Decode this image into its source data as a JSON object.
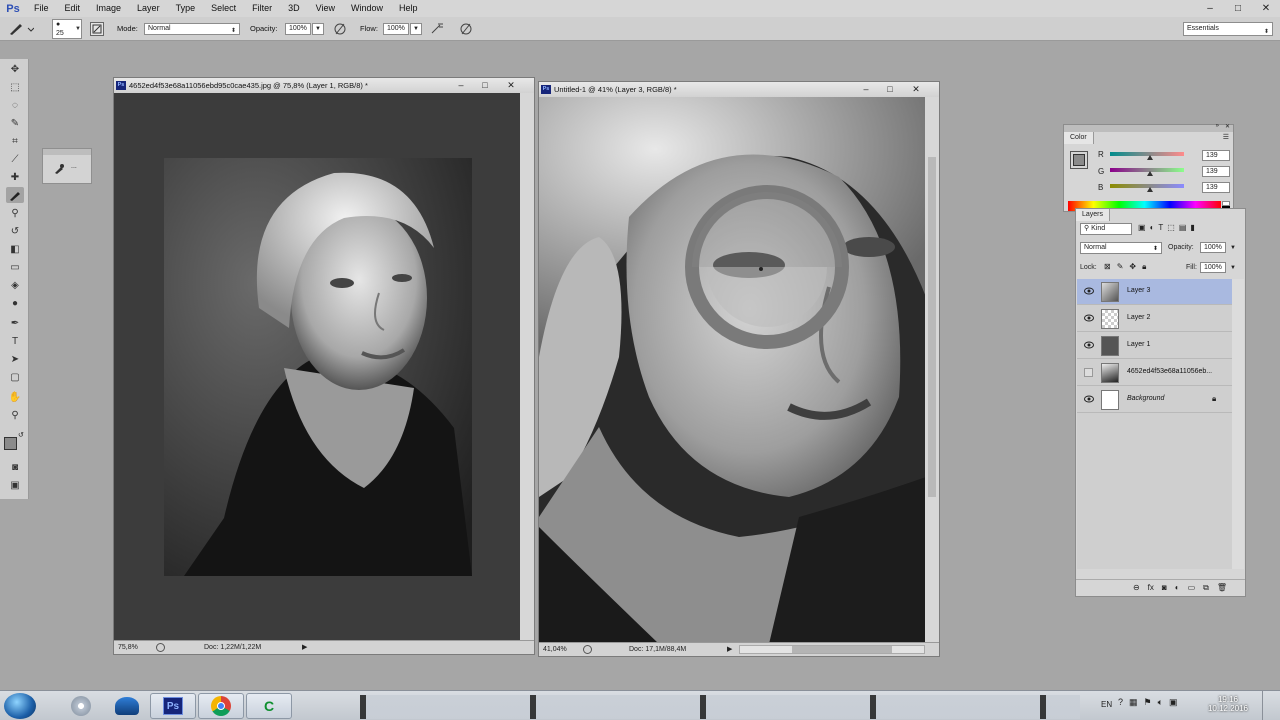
{
  "app": {
    "logo": "Ps"
  },
  "menu": [
    "File",
    "Edit",
    "Image",
    "Layer",
    "Type",
    "Select",
    "Filter",
    "3D",
    "View",
    "Window",
    "Help"
  ],
  "window_controls": {
    "minimize": "–",
    "maximize": "□",
    "close": "✕"
  },
  "options": {
    "brush_size": "25",
    "mode_label": "Mode:",
    "mode_value": "Normal",
    "opacity_label": "Opacity:",
    "opacity_value": "100%",
    "flow_label": "Flow:",
    "flow_value": "100%",
    "workspace": "Essentials"
  },
  "brush_panel": {
    "label": "..."
  },
  "doc1": {
    "title": "4652ed4f53e68a11056ebd95c0cae435.jpg @ 75,8% (Layer 1, RGB/8) *",
    "zoom": "75,8%",
    "doc_info": "Doc: 1,22M/1,22M"
  },
  "doc2": {
    "title": "Untitled-1 @ 41% (Layer 3, RGB/8) *",
    "zoom": "41,04%",
    "doc_info": "Doc: 17,1M/88,4M"
  },
  "color_panel": {
    "tab": "Color",
    "r_label": "R",
    "g_label": "G",
    "b_label": "B",
    "r": "139",
    "g": "139",
    "b": "139",
    "level": 0.545,
    "swatch": "#8b8b8b"
  },
  "layers_panel": {
    "tab": "Layers",
    "filter": "Kind",
    "blend_mode": "Normal",
    "opacity_label": "Opacity:",
    "opacity_value": "100%",
    "lock_label": "Lock:",
    "fill_label": "Fill:",
    "fill_value": "100%",
    "layers": [
      {
        "name": "Layer 3",
        "visible": true,
        "selected": true
      },
      {
        "name": "Layer 2",
        "visible": true,
        "selected": false
      },
      {
        "name": "Layer 1",
        "visible": true,
        "selected": false
      },
      {
        "name": "4652ed4f53e68a11056eb...",
        "visible": false,
        "selected": false
      },
      {
        "name": "Background",
        "visible": true,
        "selected": false,
        "locked": true
      }
    ]
  },
  "taskbar": {
    "time": "19:16",
    "date": "10.12.2016",
    "lang": "EN"
  },
  "colors": {
    "menubar": "#d6d6d6",
    "workspace": "#a6a6a6",
    "selection": "#a9b9e0"
  }
}
